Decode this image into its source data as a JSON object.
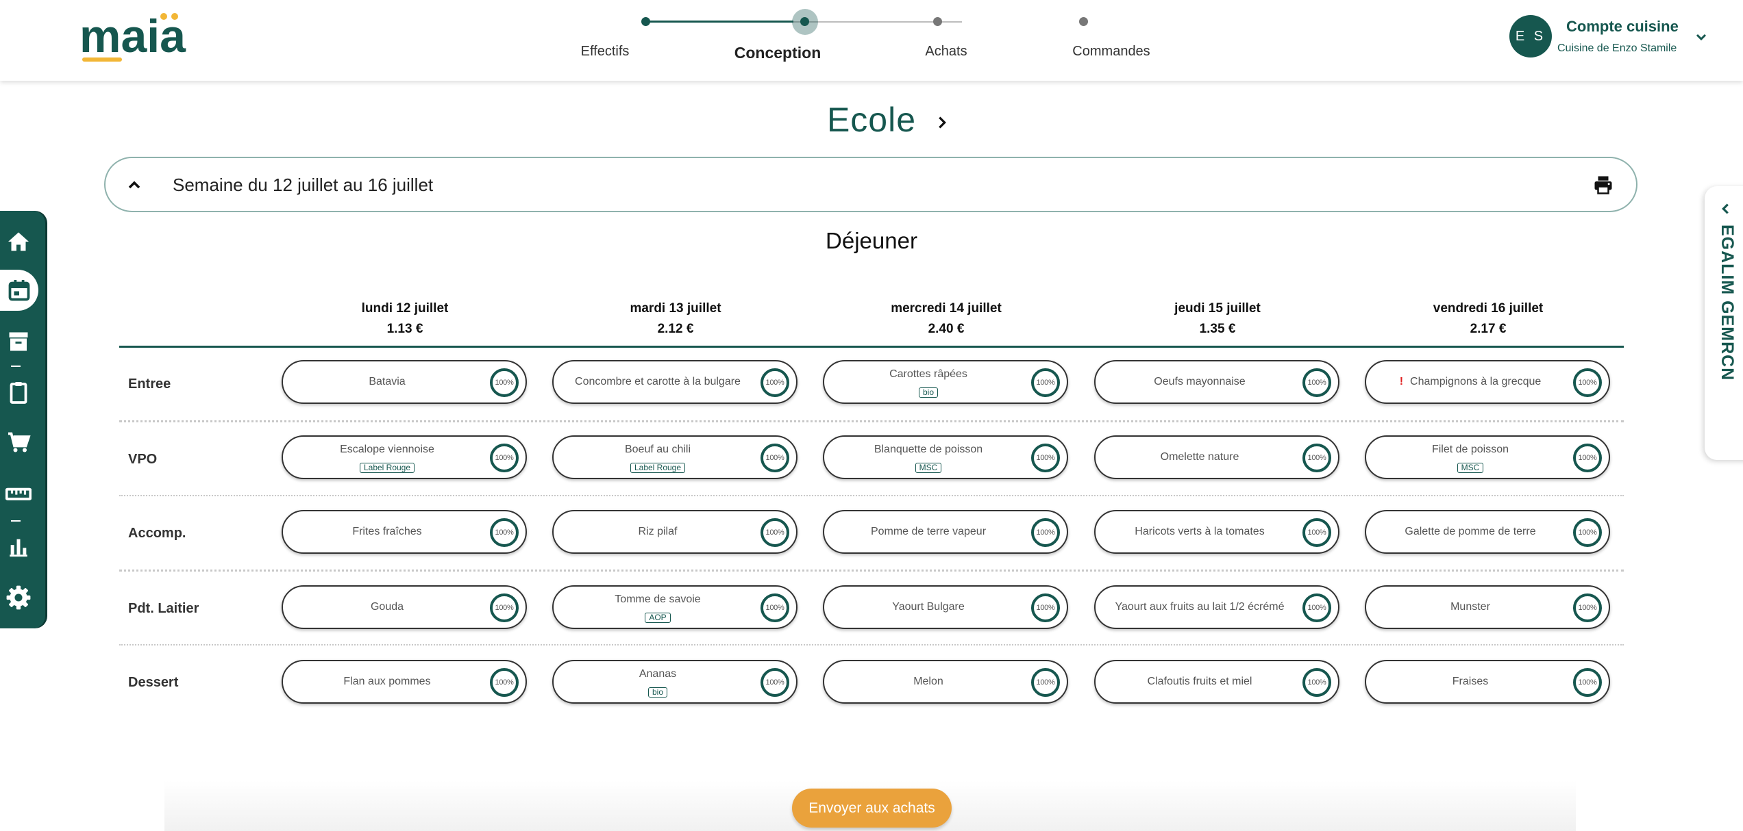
{
  "header": {
    "logo_text": "maia",
    "steps": [
      {
        "label": "Effectifs",
        "state": "done"
      },
      {
        "label": "Conception",
        "state": "active"
      },
      {
        "label": "Achats",
        "state": "todo"
      },
      {
        "label": "Commandes",
        "state": "todo"
      }
    ],
    "account": {
      "initials": "E S",
      "name": "Compte cuisine",
      "subtitle": "Cuisine de Enzo Stamile"
    }
  },
  "sidebar": {
    "items": [
      {
        "icon": "home-icon"
      },
      {
        "icon": "calendar-icon",
        "active": true
      },
      {
        "icon": "archive-icon"
      },
      {
        "icon": "clipboard-icon"
      },
      {
        "icon": "cart-icon"
      },
      {
        "icon": "ruler-icon"
      },
      {
        "icon": "bar-chart-icon"
      },
      {
        "icon": "gear-icon"
      }
    ]
  },
  "egalim_tab": {
    "label": "EGALIM GEMRCN"
  },
  "main": {
    "title": "Ecole",
    "week_label": "Semaine du 12 juillet au 16 juillet",
    "meal_title": "Déjeuner",
    "days": [
      {
        "name": "lundi 12 juillet",
        "price": "1.13 €"
      },
      {
        "name": "mardi 13 juillet",
        "price": "2.12 €"
      },
      {
        "name": "mercredi 14 juillet",
        "price": "2.40 €"
      },
      {
        "name": "jeudi 15 juillet",
        "price": "1.35 €"
      },
      {
        "name": "vendredi 16 juillet",
        "price": "2.17 €"
      }
    ],
    "rows": [
      {
        "label": "Entree",
        "dishes": [
          {
            "name": "Batavia",
            "pct": "100%"
          },
          {
            "name": "Concombre et carotte à la bulgare",
            "pct": "100%"
          },
          {
            "name": "Carottes râpées",
            "badge": "bio",
            "pct": "100%"
          },
          {
            "name": "Oeufs mayonnaise",
            "pct": "100%"
          },
          {
            "name": "Champignons à la grecque",
            "warning": "!",
            "pct": "100%"
          }
        ]
      },
      {
        "label": "VPO",
        "dishes": [
          {
            "name": "Escalope viennoise",
            "badge": "Label Rouge",
            "pct": "100%"
          },
          {
            "name": "Boeuf au chili",
            "badge": "Label Rouge",
            "pct": "100%"
          },
          {
            "name": "Blanquette de poisson",
            "badge": "MSC",
            "pct": "100%"
          },
          {
            "name": "Omelette nature",
            "pct": "100%"
          },
          {
            "name": "Filet de poisson",
            "badge": "MSC",
            "pct": "100%"
          }
        ]
      },
      {
        "label": "Accomp.",
        "dishes": [
          {
            "name": "Frites fraîches",
            "pct": "100%"
          },
          {
            "name": "Riz pilaf",
            "pct": "100%"
          },
          {
            "name": "Pomme de terre vapeur",
            "pct": "100%"
          },
          {
            "name": "Haricots verts à la tomates",
            "pct": "100%"
          },
          {
            "name": "Galette de pomme de terre",
            "pct": "100%"
          }
        ]
      },
      {
        "label": "Pdt. Laitier",
        "dishes": [
          {
            "name": "Gouda",
            "pct": "100%"
          },
          {
            "name": "Tomme de savoie",
            "badge": "AOP",
            "pct": "100%"
          },
          {
            "name": "Yaourt Bulgare",
            "pct": "100%"
          },
          {
            "name": "Yaourt aux fruits au lait 1/2 écrémé",
            "pct": "100%"
          },
          {
            "name": "Munster",
            "pct": "100%"
          }
        ]
      },
      {
        "label": "Dessert",
        "dishes": [
          {
            "name": "Flan aux pommes",
            "pct": "100%"
          },
          {
            "name": "Ananas",
            "badge": "bio",
            "pct": "100%"
          },
          {
            "name": "Melon",
            "pct": "100%"
          },
          {
            "name": "Clafoutis fruits et miel",
            "pct": "100%"
          },
          {
            "name": "Fraises",
            "pct": "100%"
          }
        ]
      }
    ],
    "send_button": "Envoyer aux achats"
  },
  "colors": {
    "primary": "#16574f",
    "accent": "#eaa23c",
    "logo_dots": "#f2b636",
    "warning": "#e02020"
  }
}
